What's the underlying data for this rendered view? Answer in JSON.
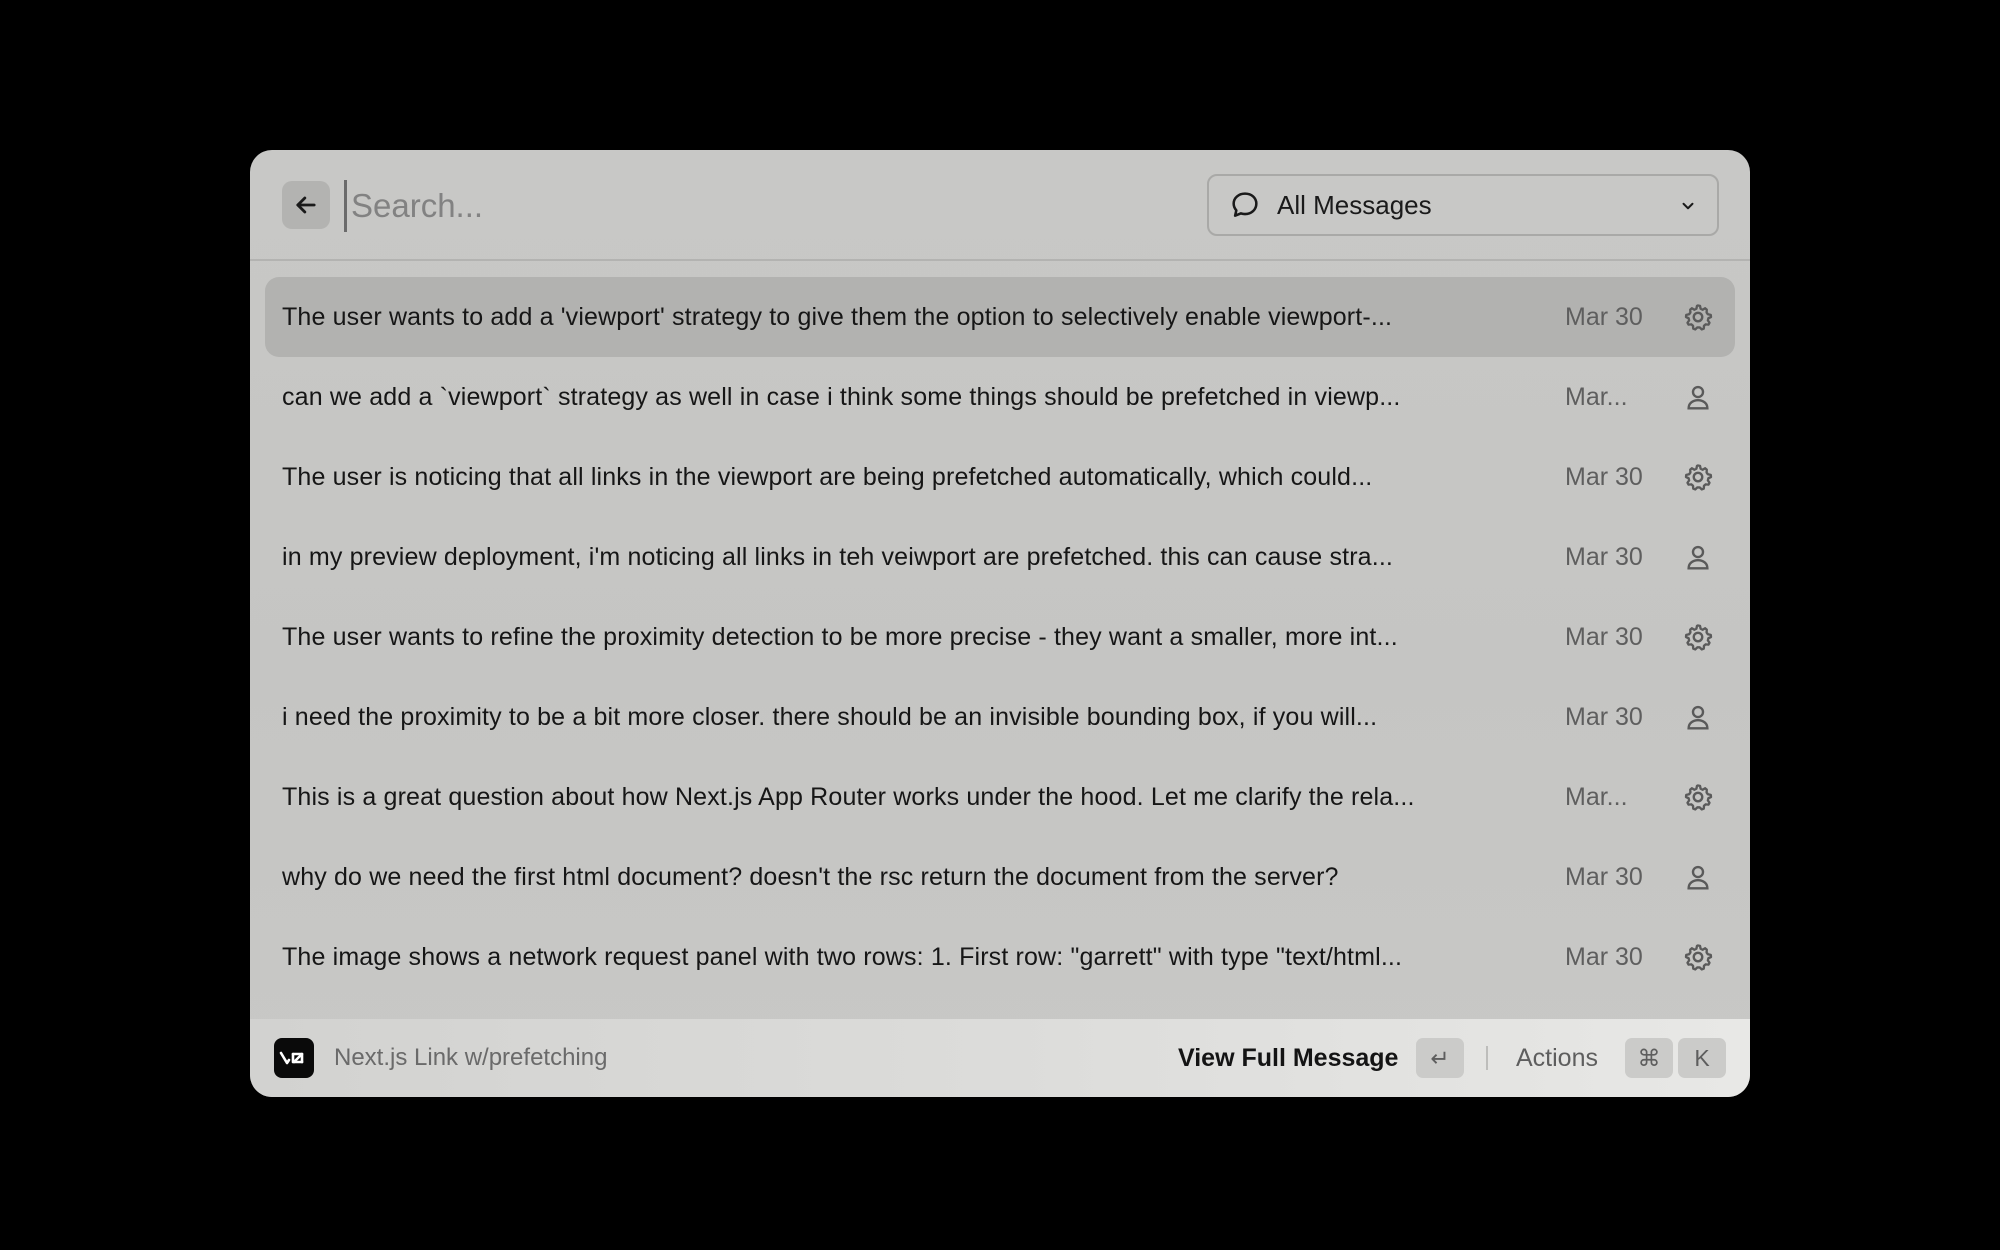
{
  "search": {
    "placeholder": "Search..."
  },
  "filter": {
    "icon": "chat-bubble-icon",
    "label": "All Messages"
  },
  "messages": [
    {
      "text": "The user wants to add a 'viewport' strategy to give them the option to selectively enable viewport-...",
      "date": "Mar 30",
      "role": "assistant",
      "selected": true
    },
    {
      "text": "can we add a `viewport` strategy as well in case i think some things should be prefetched in viewp...",
      "date": "Mar...",
      "role": "user"
    },
    {
      "text": "The user is noticing that all links in the viewport are being prefetched automatically, which could...",
      "date": "Mar 30",
      "role": "assistant"
    },
    {
      "text": "in my preview deployment, i'm noticing all links in teh veiwport are prefetched. this can cause stra...",
      "date": "Mar 30",
      "role": "user"
    },
    {
      "text": "The user wants to refine the proximity detection to be more precise - they want a smaller, more int...",
      "date": "Mar 30",
      "role": "assistant"
    },
    {
      "text": "i need the proximity to be a bit more closer. there should be an invisible bounding box, if you will...",
      "date": "Mar 30",
      "role": "user"
    },
    {
      "text": "This is a great question about how Next.js App Router works under the hood. Let me clarify the rela...",
      "date": "Mar...",
      "role": "assistant"
    },
    {
      "text": "why do we need the first html document? doesn't the rsc return the document from the server?",
      "date": "Mar 30",
      "role": "user"
    },
    {
      "text": "The image shows a network request panel with two rows: 1. First row: \"garrett\" with type \"text/html...",
      "date": "Mar 30",
      "role": "assistant"
    }
  ],
  "footer": {
    "project_name": "Next.js Link w/prefetching",
    "view_full_label": "View Full Message",
    "enter_key": "↵",
    "actions_label": "Actions",
    "cmd_key": "⌘",
    "k_key": "K"
  }
}
